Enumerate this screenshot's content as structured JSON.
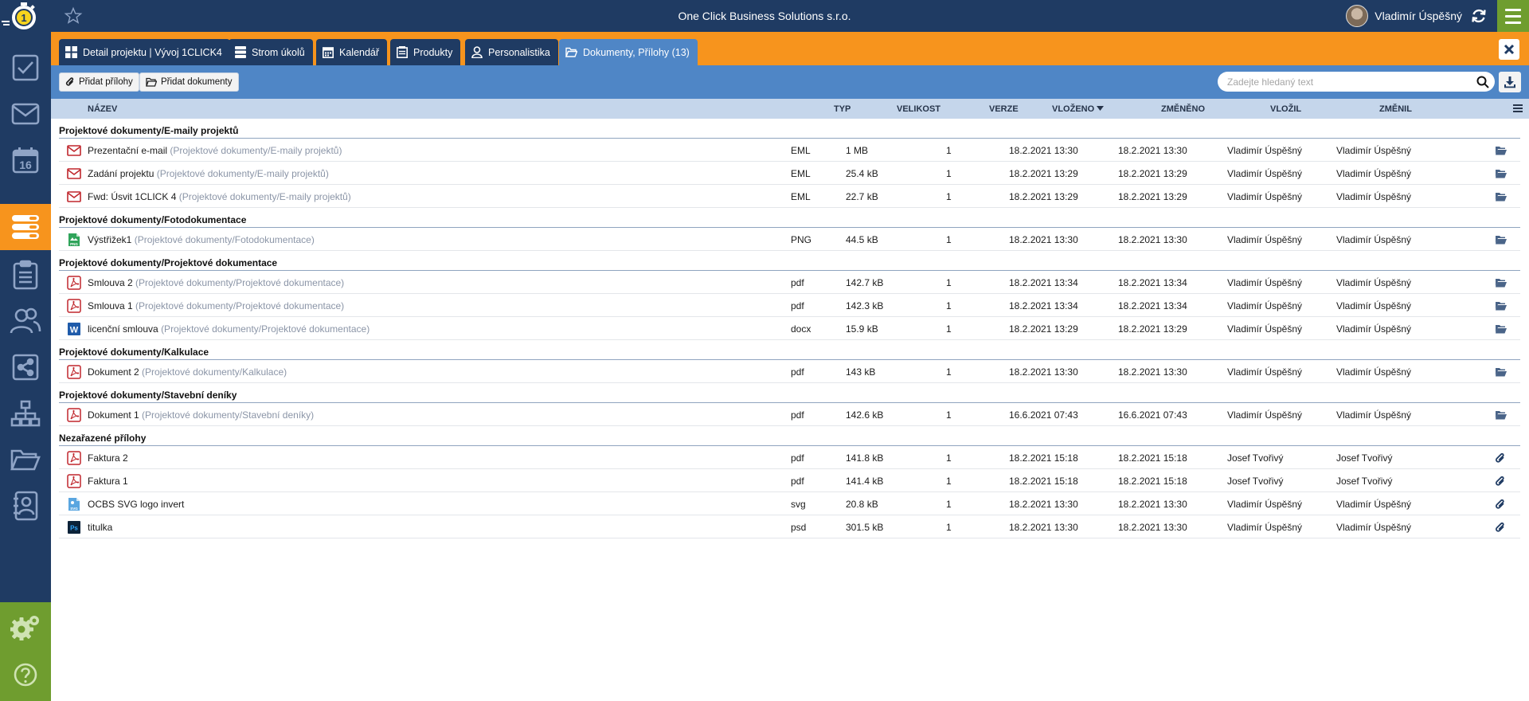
{
  "app": {
    "company": "One Click Business Solutions s.r.o.",
    "user_name": "Vladimír Úspěšný",
    "logo_digit": "1"
  },
  "colors": {
    "navy": "#1f3b63",
    "orange": "#f7941d",
    "blue": "#4f86c6",
    "green": "#6f9d2f",
    "header_row": "#c5d6eb"
  },
  "sidebar": {
    "items": [
      {
        "icon": "checkbox-icon"
      },
      {
        "icon": "envelope-icon"
      },
      {
        "icon": "calendar-icon",
        "label": "16"
      },
      {
        "icon": "stack-icon",
        "active": true
      },
      {
        "icon": "clipboard-icon"
      },
      {
        "icon": "people-icon"
      },
      {
        "icon": "share-icon"
      },
      {
        "icon": "org-chart-icon"
      },
      {
        "icon": "folder-icon"
      },
      {
        "icon": "contact-book-icon"
      }
    ],
    "bottom": [
      {
        "icon": "gears-icon"
      },
      {
        "icon": "help-icon"
      }
    ]
  },
  "tabs": [
    {
      "label": "Detail projektu | Vývoj 1CLICK4",
      "icon": "grid-icon"
    },
    {
      "label": "Strom úkolů",
      "icon": "list-icon"
    },
    {
      "label": "Kalendář",
      "icon": "calendar-icon"
    },
    {
      "label": "Produkty",
      "icon": "register-icon"
    },
    {
      "label": "Personalistika",
      "icon": "person-icon"
    },
    {
      "label": "Dokumenty, Přílohy (13)",
      "icon": "folder-open-icon",
      "active": true
    }
  ],
  "toolbar": {
    "add_attachments": "Přidat přílohy",
    "add_documents": "Přidat dokumenty",
    "search_placeholder": "Zadejte hledaný text"
  },
  "columns": {
    "name": "NÁZEV",
    "type": "TYP",
    "size": "VELIKOST",
    "version": "VERZE",
    "inserted": "VLOŽENO",
    "changed": "ZMĚNĚNO",
    "inserted_by": "VLOŽIL",
    "changed_by": "ZMĚNIL"
  },
  "groups": [
    {
      "title": "Projektové dokumenty/E-maily projektů",
      "rows": [
        {
          "icon": "email-file-icon",
          "name": "Prezentační e-mail",
          "path": "(Projektové dokumenty/E-maily projektů)",
          "type": "EML",
          "size": "1 MB",
          "version": "1",
          "inserted": "18.2.2021 13:30",
          "changed": "18.2.2021 13:30",
          "inserted_by": "Vladimír Úspěšný",
          "changed_by": "Vladimír Úspěšný",
          "action": "folder-link-icon"
        },
        {
          "icon": "email-file-icon",
          "name": "Zadání projektu",
          "path": "(Projektové dokumenty/E-maily projektů)",
          "type": "EML",
          "size": "25.4 kB",
          "version": "1",
          "inserted": "18.2.2021 13:29",
          "changed": "18.2.2021 13:29",
          "inserted_by": "Vladimír Úspěšný",
          "changed_by": "Vladimír Úspěšný",
          "action": "folder-link-icon"
        },
        {
          "icon": "email-file-icon",
          "name": "Fwd: Úsvit 1CLICK 4",
          "path": "(Projektové dokumenty/E-maily projektů)",
          "type": "EML",
          "size": "22.7 kB",
          "version": "1",
          "inserted": "18.2.2021 13:29",
          "changed": "18.2.2021 13:29",
          "inserted_by": "Vladimír Úspěšný",
          "changed_by": "Vladimír Úspěšný",
          "action": "folder-link-icon"
        }
      ]
    },
    {
      "title": "Projektové dokumenty/Fotodokumentace",
      "rows": [
        {
          "icon": "png-file-icon",
          "name": "Výstřižek1",
          "path": "(Projektové dokumenty/Fotodokumentace)",
          "type": "PNG",
          "size": "44.5 kB",
          "version": "1",
          "inserted": "18.2.2021 13:30",
          "changed": "18.2.2021 13:30",
          "inserted_by": "Vladimír Úspěšný",
          "changed_by": "Vladimír Úspěšný",
          "action": "folder-link-icon"
        }
      ]
    },
    {
      "title": "Projektové dokumenty/Projektové dokumentace",
      "rows": [
        {
          "icon": "pdf-file-icon",
          "name": "Smlouva 2",
          "path": "(Projektové dokumenty/Projektové dokumentace)",
          "type": "pdf",
          "size": "142.7 kB",
          "version": "1",
          "inserted": "18.2.2021 13:34",
          "changed": "18.2.2021 13:34",
          "inserted_by": "Vladimír Úspěšný",
          "changed_by": "Vladimír Úspěšný",
          "action": "folder-link-icon"
        },
        {
          "icon": "pdf-file-icon",
          "name": "Smlouva 1",
          "path": "(Projektové dokumenty/Projektové dokumentace)",
          "type": "pdf",
          "size": "142.3 kB",
          "version": "1",
          "inserted": "18.2.2021 13:34",
          "changed": "18.2.2021 13:34",
          "inserted_by": "Vladimír Úspěšný",
          "changed_by": "Vladimír Úspěšný",
          "action": "folder-link-icon"
        },
        {
          "icon": "word-file-icon",
          "name": "licenční smlouva",
          "path": "(Projektové dokumenty/Projektové dokumentace)",
          "type": "docx",
          "size": "15.9 kB",
          "version": "1",
          "inserted": "18.2.2021 13:29",
          "changed": "18.2.2021 13:29",
          "inserted_by": "Vladimír Úspěšný",
          "changed_by": "Vladimír Úspěšný",
          "action": "folder-link-icon"
        }
      ]
    },
    {
      "title": "Projektové dokumenty/Kalkulace",
      "rows": [
        {
          "icon": "pdf-file-icon",
          "name": "Dokument 2",
          "path": "(Projektové dokumenty/Kalkulace)",
          "type": "pdf",
          "size": "143 kB",
          "version": "1",
          "inserted": "18.2.2021 13:30",
          "changed": "18.2.2021 13:30",
          "inserted_by": "Vladimír Úspěšný",
          "changed_by": "Vladimír Úspěšný",
          "action": "folder-link-icon"
        }
      ]
    },
    {
      "title": "Projektové dokumenty/Stavební deníky",
      "rows": [
        {
          "icon": "pdf-file-icon",
          "name": "Dokument 1",
          "path": "(Projektové dokumenty/Stavební deníky)",
          "type": "pdf",
          "size": "142.6 kB",
          "version": "1",
          "inserted": "16.6.2021 07:43",
          "changed": "16.6.2021 07:43",
          "inserted_by": "Vladimír Úspěšný",
          "changed_by": "Vladimír Úspěšný",
          "action": "folder-link-icon"
        }
      ]
    },
    {
      "title": "Nezařazené přílohy",
      "rows": [
        {
          "icon": "pdf-file-icon",
          "name": "Faktura 2",
          "path": "",
          "type": "pdf",
          "size": "141.8 kB",
          "version": "1",
          "inserted": "18.2.2021 15:18",
          "changed": "18.2.2021 15:18",
          "inserted_by": "Josef Tvořivý",
          "changed_by": "Josef Tvořivý",
          "action": "paperclip-icon"
        },
        {
          "icon": "pdf-file-icon",
          "name": "Faktura 1",
          "path": "",
          "type": "pdf",
          "size": "141.4 kB",
          "version": "1",
          "inserted": "18.2.2021 15:18",
          "changed": "18.2.2021 15:18",
          "inserted_by": "Josef Tvořivý",
          "changed_by": "Josef Tvořivý",
          "action": "paperclip-icon"
        },
        {
          "icon": "svg-file-icon",
          "name": "OCBS SVG logo invert",
          "path": "",
          "type": "svg",
          "size": "20.8 kB",
          "version": "1",
          "inserted": "18.2.2021 13:30",
          "changed": "18.2.2021 13:30",
          "inserted_by": "Vladimír Úspěšný",
          "changed_by": "Vladimír Úspěšný",
          "action": "paperclip-icon"
        },
        {
          "icon": "psd-file-icon",
          "name": "titulka",
          "path": "",
          "type": "psd",
          "size": "301.5 kB",
          "version": "1",
          "inserted": "18.2.2021 13:30",
          "changed": "18.2.2021 13:30",
          "inserted_by": "Vladimír Úspěšný",
          "changed_by": "Vladimír Úspěšný",
          "action": "paperclip-icon"
        }
      ]
    }
  ]
}
